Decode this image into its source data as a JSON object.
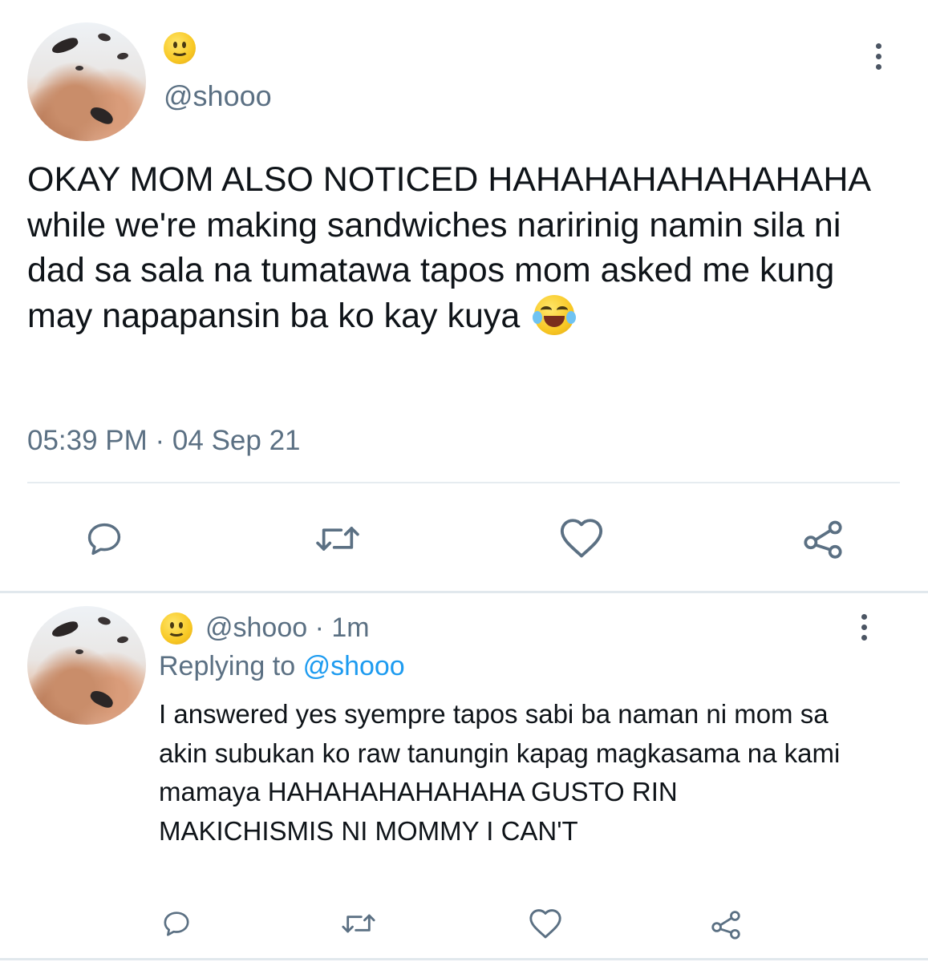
{
  "main_tweet": {
    "display_name_emoji": "smiling-face",
    "handle": "@shooo",
    "text": "OKAY MOM ALSO NOTICED HAHAHAHAHAHAHAHA while we're making sandwiches naririnig namin sila ni dad sa sala na tumatawa tapos mom asked me kung may napapansin ba ko kay kuya",
    "text_emoji": "face-with-tears-of-joy",
    "timestamp": "05:39 PM · 04 Sep 21",
    "actions": [
      "reply-icon",
      "retweet-icon",
      "like-icon",
      "share-icon"
    ]
  },
  "reply_tweet": {
    "display_name_emoji": "smiling-face",
    "handle": "@shooo",
    "time": "· 1m",
    "replying_to_label": "Replying to",
    "replying_to_handle": "@shooo",
    "text": "I answered yes syempre tapos sabi ba naman ni mom sa akin subukan ko raw tanungin kapag magkasama na kami mamaya HAHAHAHAHAHAHA GUSTO RIN MAKICHISMIS NI MOMMY I CAN'T",
    "actions": [
      "reply-icon",
      "retweet-icon",
      "like-icon",
      "share-icon"
    ]
  },
  "colors": {
    "text": "#0f1419",
    "secondary": "#5b7083",
    "link": "#1d9bf0",
    "divider": "#e6ecf0"
  }
}
